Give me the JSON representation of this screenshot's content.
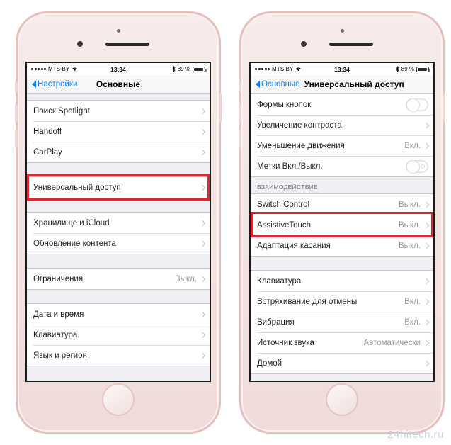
{
  "statusbar": {
    "carrier": "MTS BY",
    "time": "13:34",
    "battery_percent": "89 %",
    "signal_dots": 5,
    "wifi_icon": "wifi-icon",
    "bluetooth_icon": "bluetooth-icon",
    "battery_icon": "battery-icon"
  },
  "left_phone": {
    "nav": {
      "back_label": "Настройки",
      "title": "Основные"
    },
    "groups": [
      {
        "rows": [
          {
            "label": "Поиск Spotlight",
            "value": "",
            "accessory": "chevron"
          },
          {
            "label": "Handoff",
            "value": "",
            "accessory": "chevron"
          },
          {
            "label": "CarPlay",
            "value": "",
            "accessory": "chevron"
          }
        ]
      },
      {
        "highlighted": true,
        "rows": [
          {
            "label": "Универсальный доступ",
            "value": "",
            "accessory": "chevron"
          }
        ]
      },
      {
        "rows": [
          {
            "label": "Хранилище и iCloud",
            "value": "",
            "accessory": "chevron"
          },
          {
            "label": "Обновление контента",
            "value": "",
            "accessory": "chevron"
          }
        ]
      },
      {
        "rows": [
          {
            "label": "Ограничения",
            "value": "Выкл.",
            "accessory": "chevron"
          }
        ]
      },
      {
        "rows": [
          {
            "label": "Дата и время",
            "value": "",
            "accessory": "chevron"
          },
          {
            "label": "Клавиатура",
            "value": "",
            "accessory": "chevron"
          },
          {
            "label": "Язык и регион",
            "value": "",
            "accessory": "chevron"
          }
        ]
      }
    ]
  },
  "right_phone": {
    "nav": {
      "back_label": "Основные",
      "title": "Универсальный доступ"
    },
    "groups": [
      {
        "rows": [
          {
            "label": "Формы кнопок",
            "value": "",
            "accessory": "toggle-off"
          },
          {
            "label": "Увеличение контраста",
            "value": "",
            "accessory": "chevron"
          },
          {
            "label": "Уменьшение движения",
            "value": "Вкл.",
            "accessory": "chevron"
          },
          {
            "label": "Метки Вкл./Выкл.",
            "value": "",
            "accessory": "toggle-off-ring"
          }
        ]
      },
      {
        "section_header": "ВЗАИМОДЕЙСТВИЕ",
        "rows": [
          {
            "label": "Switch Control",
            "value": "Выкл.",
            "accessory": "chevron"
          },
          {
            "label": "AssistiveTouch",
            "value": "Выкл.",
            "accessory": "chevron",
            "highlighted": true
          },
          {
            "label": "Адаптация касания",
            "value": "Выкл.",
            "accessory": "chevron"
          }
        ]
      },
      {
        "rows": [
          {
            "label": "Клавиатура",
            "value": "",
            "accessory": "chevron"
          },
          {
            "label": "Встряхивание для отмены",
            "value": "Вкл.",
            "accessory": "chevron"
          },
          {
            "label": "Вибрация",
            "value": "Вкл.",
            "accessory": "chevron"
          },
          {
            "label": "Источник звука",
            "value": "Автоматически",
            "accessory": "chevron"
          },
          {
            "label": "Домой",
            "value": "",
            "accessory": "chevron"
          }
        ]
      }
    ]
  },
  "watermark": "24hitech.ru",
  "colors": {
    "highlight": "#e0262c",
    "tint": "#0a7cf0",
    "list_bg": "#efeff4",
    "frame": "#f0ddda"
  }
}
